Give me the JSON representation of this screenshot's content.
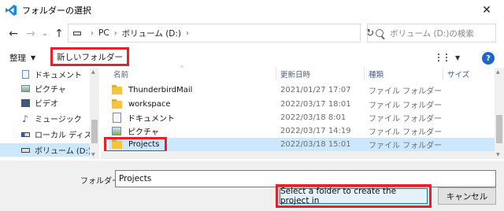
{
  "window": {
    "title": "フォルダーの選択",
    "close_glyph": "✕"
  },
  "address": {
    "back_glyph": "←",
    "forward_glyph": "→",
    "recent_glyph": "⌄",
    "up_glyph": "↑",
    "crumbs": [
      "PC",
      "ボリューム (D:)"
    ],
    "separator": "›",
    "refresh_glyph": "↻",
    "search_placeholder": "ボリューム (D:)の検索"
  },
  "toolbar": {
    "organize_label": "整理",
    "caret_glyph": "▼",
    "new_folder_label": "新しいフォルダー",
    "help_glyph": "?"
  },
  "sidebar": {
    "items": [
      {
        "label": "ドキュメント",
        "icon": "document-icon"
      },
      {
        "label": "ピクチャ",
        "icon": "picture-icon"
      },
      {
        "label": "ビデオ",
        "icon": "video-icon"
      },
      {
        "label": "ミュージック",
        "icon": "music-icon"
      },
      {
        "label": "ローカル ディスク (C",
        "icon": "disk-icon"
      },
      {
        "label": "ボリューム (D:)",
        "icon": "disk-icon",
        "selected": true
      }
    ]
  },
  "list": {
    "columns": [
      "名前",
      "更新日時",
      "種類",
      "サイズ"
    ],
    "sort_glyph": "^",
    "rows": [
      {
        "name": "ThunderbirdMail",
        "date": "2021/01/27 17:07",
        "type": "ファイル フォルダー",
        "icon": "folder-icon"
      },
      {
        "name": "workspace",
        "date": "2022/03/17 18:01",
        "type": "ファイル フォルダー",
        "icon": "folder-icon"
      },
      {
        "name": "ドキュメント",
        "date": "2022/03/18 8:01",
        "type": "ファイル フォルダー",
        "icon": "document-icon"
      },
      {
        "name": "ピクチャ",
        "date": "2022/03/17 14:19",
        "type": "ファイル フォルダー",
        "icon": "picture-icon"
      },
      {
        "name": "Projects",
        "date": "2022/03/18 15:01",
        "type": "ファイル フォルダー",
        "icon": "folder-icon",
        "selected": true
      }
    ]
  },
  "bottom": {
    "folder_label": "フォルダー:",
    "folder_value": "Projects",
    "select_button": "Select a folder to create the project in",
    "cancel_button": "キャンセル"
  },
  "colors": {
    "highlight_box": "#e8202a",
    "selection": "#cce8ff",
    "accent": "#0078d7"
  }
}
